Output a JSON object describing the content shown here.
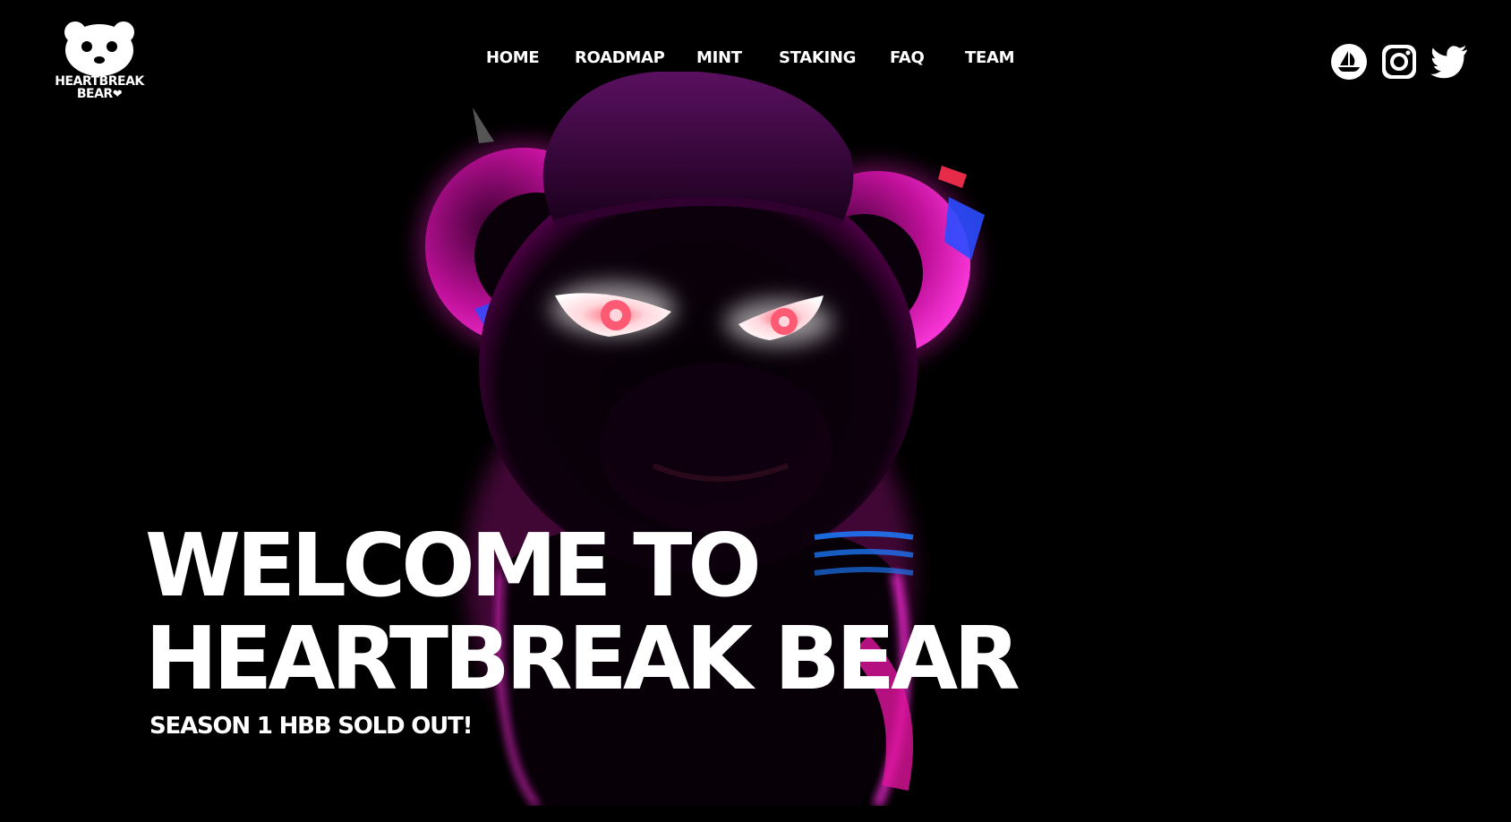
{
  "brand": {
    "logo_line1": "HEARTBREAK",
    "logo_line2": "BEAR",
    "logo_heart": "❤"
  },
  "nav": {
    "items": [
      {
        "label": "HOME"
      },
      {
        "label": "ROADMAP"
      },
      {
        "label": "MINT"
      },
      {
        "label": "STAKING"
      },
      {
        "label": "FAQ"
      },
      {
        "label": "TEAM"
      }
    ]
  },
  "socials": [
    {
      "icon": "opensea-icon"
    },
    {
      "icon": "instagram-icon"
    },
    {
      "icon": "twitter-icon"
    }
  ],
  "hero": {
    "title_line1": "WELCOME TO",
    "title_line2": "HEARTBREAK BEAR",
    "subtitle": "SEASON 1 HBB SOLD OUT!"
  },
  "colors": {
    "background": "#000000",
    "text": "#ffffff",
    "neon_magenta": "#ff1fd2",
    "neon_blue": "#2a4dff",
    "eye_glow": "#ff9aa8"
  }
}
